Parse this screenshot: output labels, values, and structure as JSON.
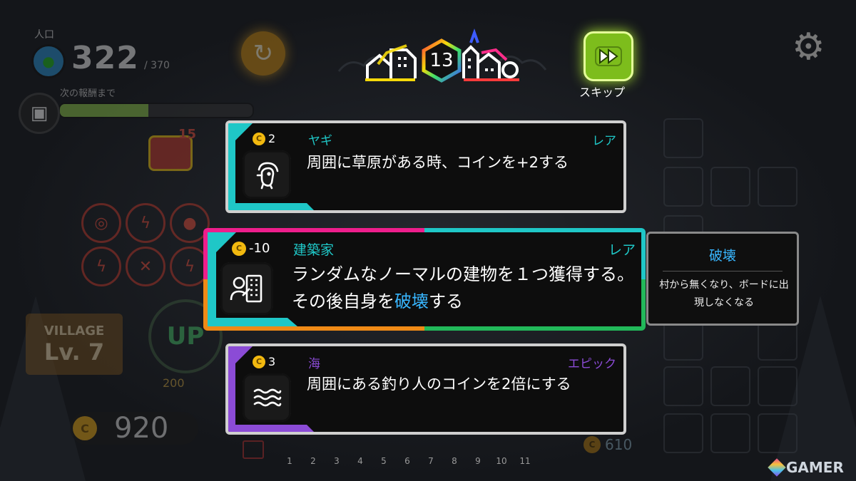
{
  "hud": {
    "population_label": "人口",
    "population_value": "322",
    "population_max": "/ 370",
    "reward_label": "次の報酬まで",
    "reward_progress": 0.46,
    "chest_count": "15",
    "village_title": "VILLAGE",
    "village_level": "Lv. 7",
    "upgrade_label": "UP",
    "upgrade_cost": "200",
    "coin_total": "920",
    "coin_secondary": "610"
  },
  "top": {
    "turn_number": "13",
    "skip_label": "スキップ"
  },
  "timeline": [
    "1",
    "2",
    "3",
    "4",
    "5",
    "6",
    "7",
    "8",
    "9",
    "10",
    "11"
  ],
  "cards": [
    {
      "cost": "2",
      "name": "ヤギ",
      "rarity": "レア",
      "description": "周囲に草原がある時、コインを+2する",
      "icon": "goat-icon",
      "accent": "#1fc7c7"
    },
    {
      "cost": "-10",
      "name": "建築家",
      "rarity": "レア",
      "description_part1": "ランダムなノーマルの建物を１つ獲得する。その後自身を",
      "description_highlight": "破壊",
      "description_part2": "する",
      "icon": "architect-icon",
      "accent": "#1fc7c7"
    },
    {
      "cost": "3",
      "name": "海",
      "rarity": "エピック",
      "description": "周囲にある釣り人のコインを2倍にする",
      "icon": "sea-waves-icon",
      "accent": "#8b4bd6"
    }
  ],
  "tooltip": {
    "title": "破壊",
    "text": "村から無くなり、ボードに出現しなくなる"
  },
  "watermark": "GAMER",
  "colors": {
    "teal": "#1fc7c7",
    "purple": "#8b4bd6",
    "highlight_blue": "#38b6ff",
    "gold": "#f2b90f"
  }
}
